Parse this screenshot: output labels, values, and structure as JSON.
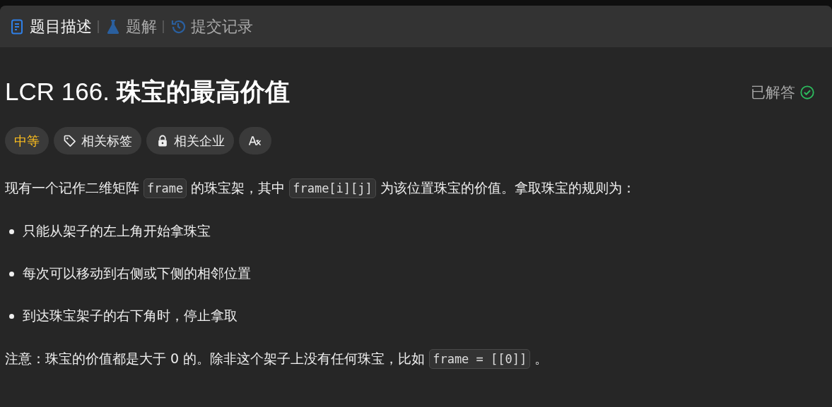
{
  "tabs": [
    {
      "label": "题目描述",
      "kind": "document",
      "selected": true
    },
    {
      "label": "题解",
      "kind": "flask",
      "selected": false
    },
    {
      "label": "提交记录",
      "kind": "history",
      "selected": false
    }
  ],
  "problem": {
    "title": "LCR 166. **珠宝的最高价值**",
    "status": "已解答",
    "solved": true
  },
  "tags": [
    {
      "kind": "difficulty",
      "label": "中等",
      "color": "#ffc01e"
    },
    {
      "kind": "topics",
      "label": "相关标签"
    },
    {
      "kind": "companies",
      "label": "相关企业"
    },
    {
      "kind": "translate"
    }
  ],
  "description": [
    {
      "kind": "paragraph",
      "segments": [
        {
          "kind": "text",
          "text": "现有一个记作二维矩阵"
        },
        {
          "kind": "code",
          "text": "frame"
        },
        {
          "kind": "text",
          "text": "的珠宝架，其中"
        },
        {
          "kind": "code",
          "text": "frame[i][j]"
        },
        {
          "kind": "text",
          "text": "为该位置珠宝的价值。拿取珠宝的规则为："
        }
      ]
    },
    {
      "kind": "bullet",
      "segments": [
        {
          "kind": "text",
          "text": "只能从架子的左上角开始拿珠宝"
        }
      ]
    },
    {
      "kind": "bullet",
      "segments": [
        {
          "kind": "text",
          "text": "每次可以移动到右侧或下侧的相邻位置"
        }
      ]
    },
    {
      "kind": "bullet",
      "segments": [
        {
          "kind": "text",
          "text": "到达珠宝架子的右下角时，停止拿取"
        }
      ]
    },
    {
      "kind": "paragraph",
      "segments": [
        {
          "kind": "text",
          "text": "注意：珠宝的价值都是大于 0 的。除非这个架子上没有任何珠宝，比如"
        },
        {
          "kind": "code",
          "text": "frame = [[0]]"
        },
        {
          "kind": "text",
          "text": "。"
        }
      ]
    }
  ]
}
